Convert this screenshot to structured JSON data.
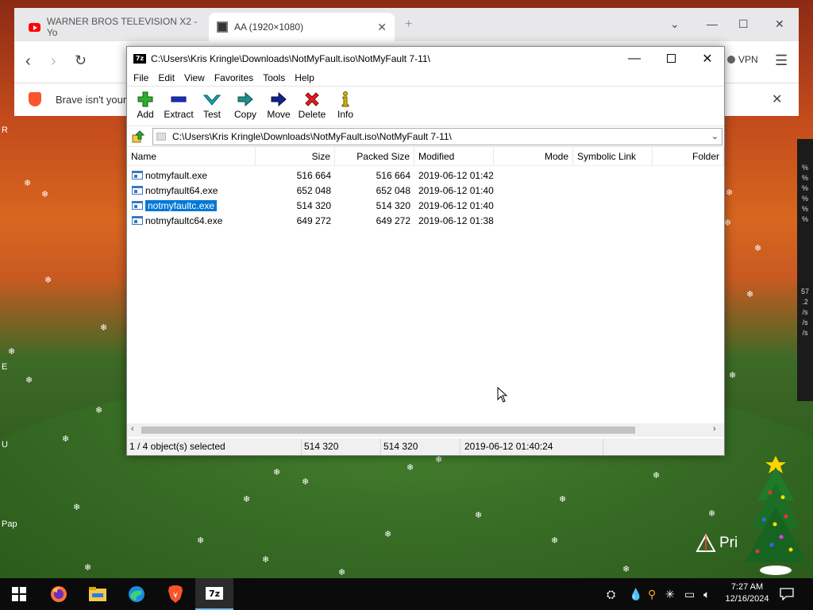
{
  "browser": {
    "tabs": [
      {
        "label": "WARNER BROS TELEVISION X2 - Yo"
      },
      {
        "label": "AA (1920×1080)"
      }
    ],
    "vpn_label": "VPN",
    "infobar_text": "Brave isn't your"
  },
  "window": {
    "title": "C:\\Users\\Kris Kringle\\Downloads\\NotMyFault.iso\\NotMyFault 7-11\\",
    "app_icon_text": "7z"
  },
  "menu": [
    "File",
    "Edit",
    "View",
    "Favorites",
    "Tools",
    "Help"
  ],
  "toolbar": [
    {
      "label": "Add",
      "icon": "plus-icon",
      "color": "#2eae2e"
    },
    {
      "label": "Extract",
      "icon": "minus-icon",
      "color": "#1a2fbf"
    },
    {
      "label": "Test",
      "icon": "check-icon",
      "color": "#18a7b5"
    },
    {
      "label": "Copy",
      "icon": "arrow-right-icon",
      "color": "#1b8f8a"
    },
    {
      "label": "Move",
      "icon": "arrow-right-icon",
      "color": "#14238c"
    },
    {
      "label": "Delete",
      "icon": "x-icon",
      "color": "#e02020"
    },
    {
      "label": "Info",
      "icon": "info-icon",
      "color": "#d6b400"
    }
  ],
  "address": "C:\\Users\\Kris Kringle\\Downloads\\NotMyFault.iso\\NotMyFault 7-11\\",
  "columns": {
    "name": "Name",
    "size": "Size",
    "packed": "Packed Size",
    "modified": "Modified",
    "mode": "Mode",
    "symlink": "Symbolic Link",
    "folder": "Folder"
  },
  "files": [
    {
      "name": "notmyfault.exe",
      "size": "516 664",
      "packed": "516 664",
      "modified": "2019-06-12 01:42",
      "selected": false
    },
    {
      "name": "notmyfault64.exe",
      "size": "652 048",
      "packed": "652 048",
      "modified": "2019-06-12 01:40",
      "selected": false
    },
    {
      "name": "notmyfaultc.exe",
      "size": "514 320",
      "packed": "514 320",
      "modified": "2019-06-12 01:40",
      "selected": true
    },
    {
      "name": "notmyfaultc64.exe",
      "size": "649 272",
      "packed": "649 272",
      "modified": "2019-06-12 01:38",
      "selected": false
    }
  ],
  "status": {
    "selection": "1 / 4 object(s) selected",
    "size": "514 320",
    "packed": "514 320",
    "modified": "2019-06-12 01:40:24"
  },
  "desktop": {
    "watermark": "Pri"
  },
  "taskbar": {
    "apps": [
      "start-icon",
      "firefox-icon",
      "file-explorer-icon",
      "edge-icon",
      "brave-icon",
      "7zip-icon"
    ],
    "time": "7:27 AM",
    "date": "12/16/2024"
  }
}
